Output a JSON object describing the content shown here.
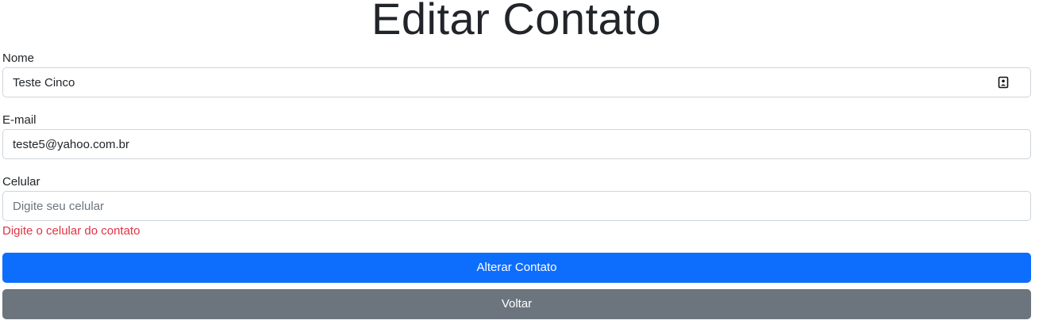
{
  "page": {
    "title": "Editar Contato"
  },
  "form": {
    "nome": {
      "label": "Nome",
      "value": "Teste Cinco",
      "placeholder": "",
      "icon": "contact-card-icon"
    },
    "email": {
      "label": "E-mail",
      "value": "teste5@yahoo.com.br",
      "placeholder": ""
    },
    "celular": {
      "label": "Celular",
      "value": "",
      "placeholder": "Digite seu celular",
      "error": "Digite o celular do contato"
    }
  },
  "actions": {
    "submit_label": "Alterar Contato",
    "back_label": "Voltar"
  },
  "colors": {
    "primary": "#0d6efd",
    "secondary": "#6c757d",
    "danger": "#dc3545",
    "border": "#ced4da"
  }
}
